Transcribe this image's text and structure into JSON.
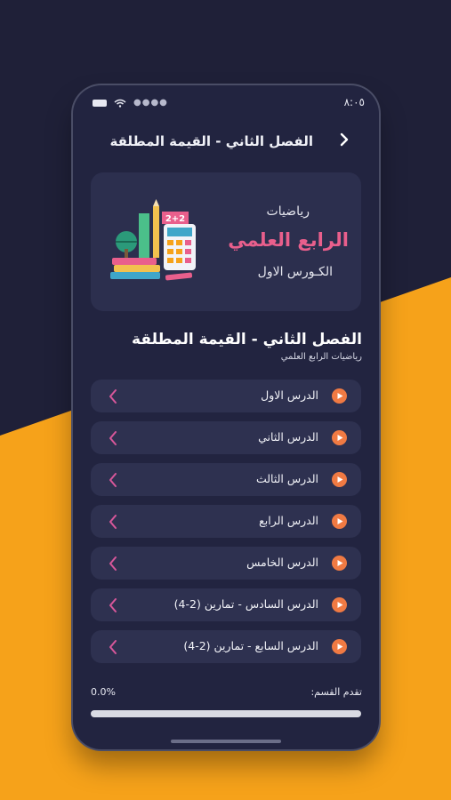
{
  "status_bar": {
    "time": "٨:٠٥"
  },
  "header": {
    "title": "الفصل الثاني - القيمة المطلقة"
  },
  "banner": {
    "line1": "رياضيات",
    "line2": "الرابع العلمي",
    "line3": "الكـورس الاول",
    "illustration_badge": "2+2"
  },
  "section": {
    "title": "الفصل الثاني - القيمة المطلقة",
    "subtitle": "رياضيات الرابع العلمي"
  },
  "lessons": [
    {
      "label": "الدرس الاول"
    },
    {
      "label": "الدرس الثاني"
    },
    {
      "label": "الدرس الثالث"
    },
    {
      "label": "الدرس الرابع"
    },
    {
      "label": "الدرس الخامس"
    },
    {
      "label": "الدرس السادس - تمارين (2-4)"
    },
    {
      "label": "الدرس السابع - تمارين (2-4)"
    }
  ],
  "progress": {
    "label": "تقدم القسم:",
    "value_text": "0.0%",
    "fraction": 0.0
  },
  "colors": {
    "background_dark": "#1f2038",
    "background_accent": "#f6a21a",
    "phone": "#222440",
    "card": "#2e3150",
    "play": "#f07a43",
    "chevron": "#d7579a",
    "title_pink": "#e95f8c"
  },
  "icons": {
    "back": "chevron-right-icon",
    "play": "play-circle-icon",
    "row_arrow": "chevron-left-icon"
  }
}
